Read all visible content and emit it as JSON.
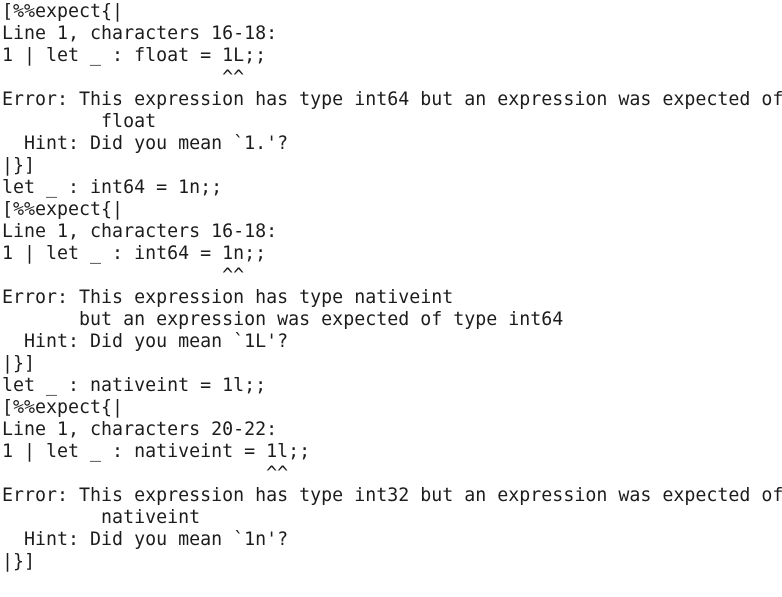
{
  "terminal": {
    "text_color": "#1c1c1c",
    "background": "#ffffff",
    "lines": [
      "[%%expect{|",
      "Line 1, characters 16-18:",
      "1 | let _ : float = 1L;;",
      "                    ^^",
      "Error: This expression has type int64 but an expression was expected of",
      "         float",
      "  Hint: Did you mean `1.'?",
      "|}]",
      "let _ : int64 = 1n;;",
      "[%%expect{|",
      "Line 1, characters 16-18:",
      "1 | let _ : int64 = 1n;;",
      "                    ^^",
      "Error: This expression has type nativeint",
      "       but an expression was expected of type int64",
      "  Hint: Did you mean `1L'?",
      "|}]",
      "let _ : nativeint = 1l;;",
      "[%%expect{|",
      "Line 1, characters 20-22:",
      "1 | let _ : nativeint = 1l;;",
      "                        ^^",
      "Error: This expression has type int32 but an expression was expected of",
      "         nativeint",
      "  Hint: Did you mean `1n'?",
      "|}]"
    ]
  }
}
